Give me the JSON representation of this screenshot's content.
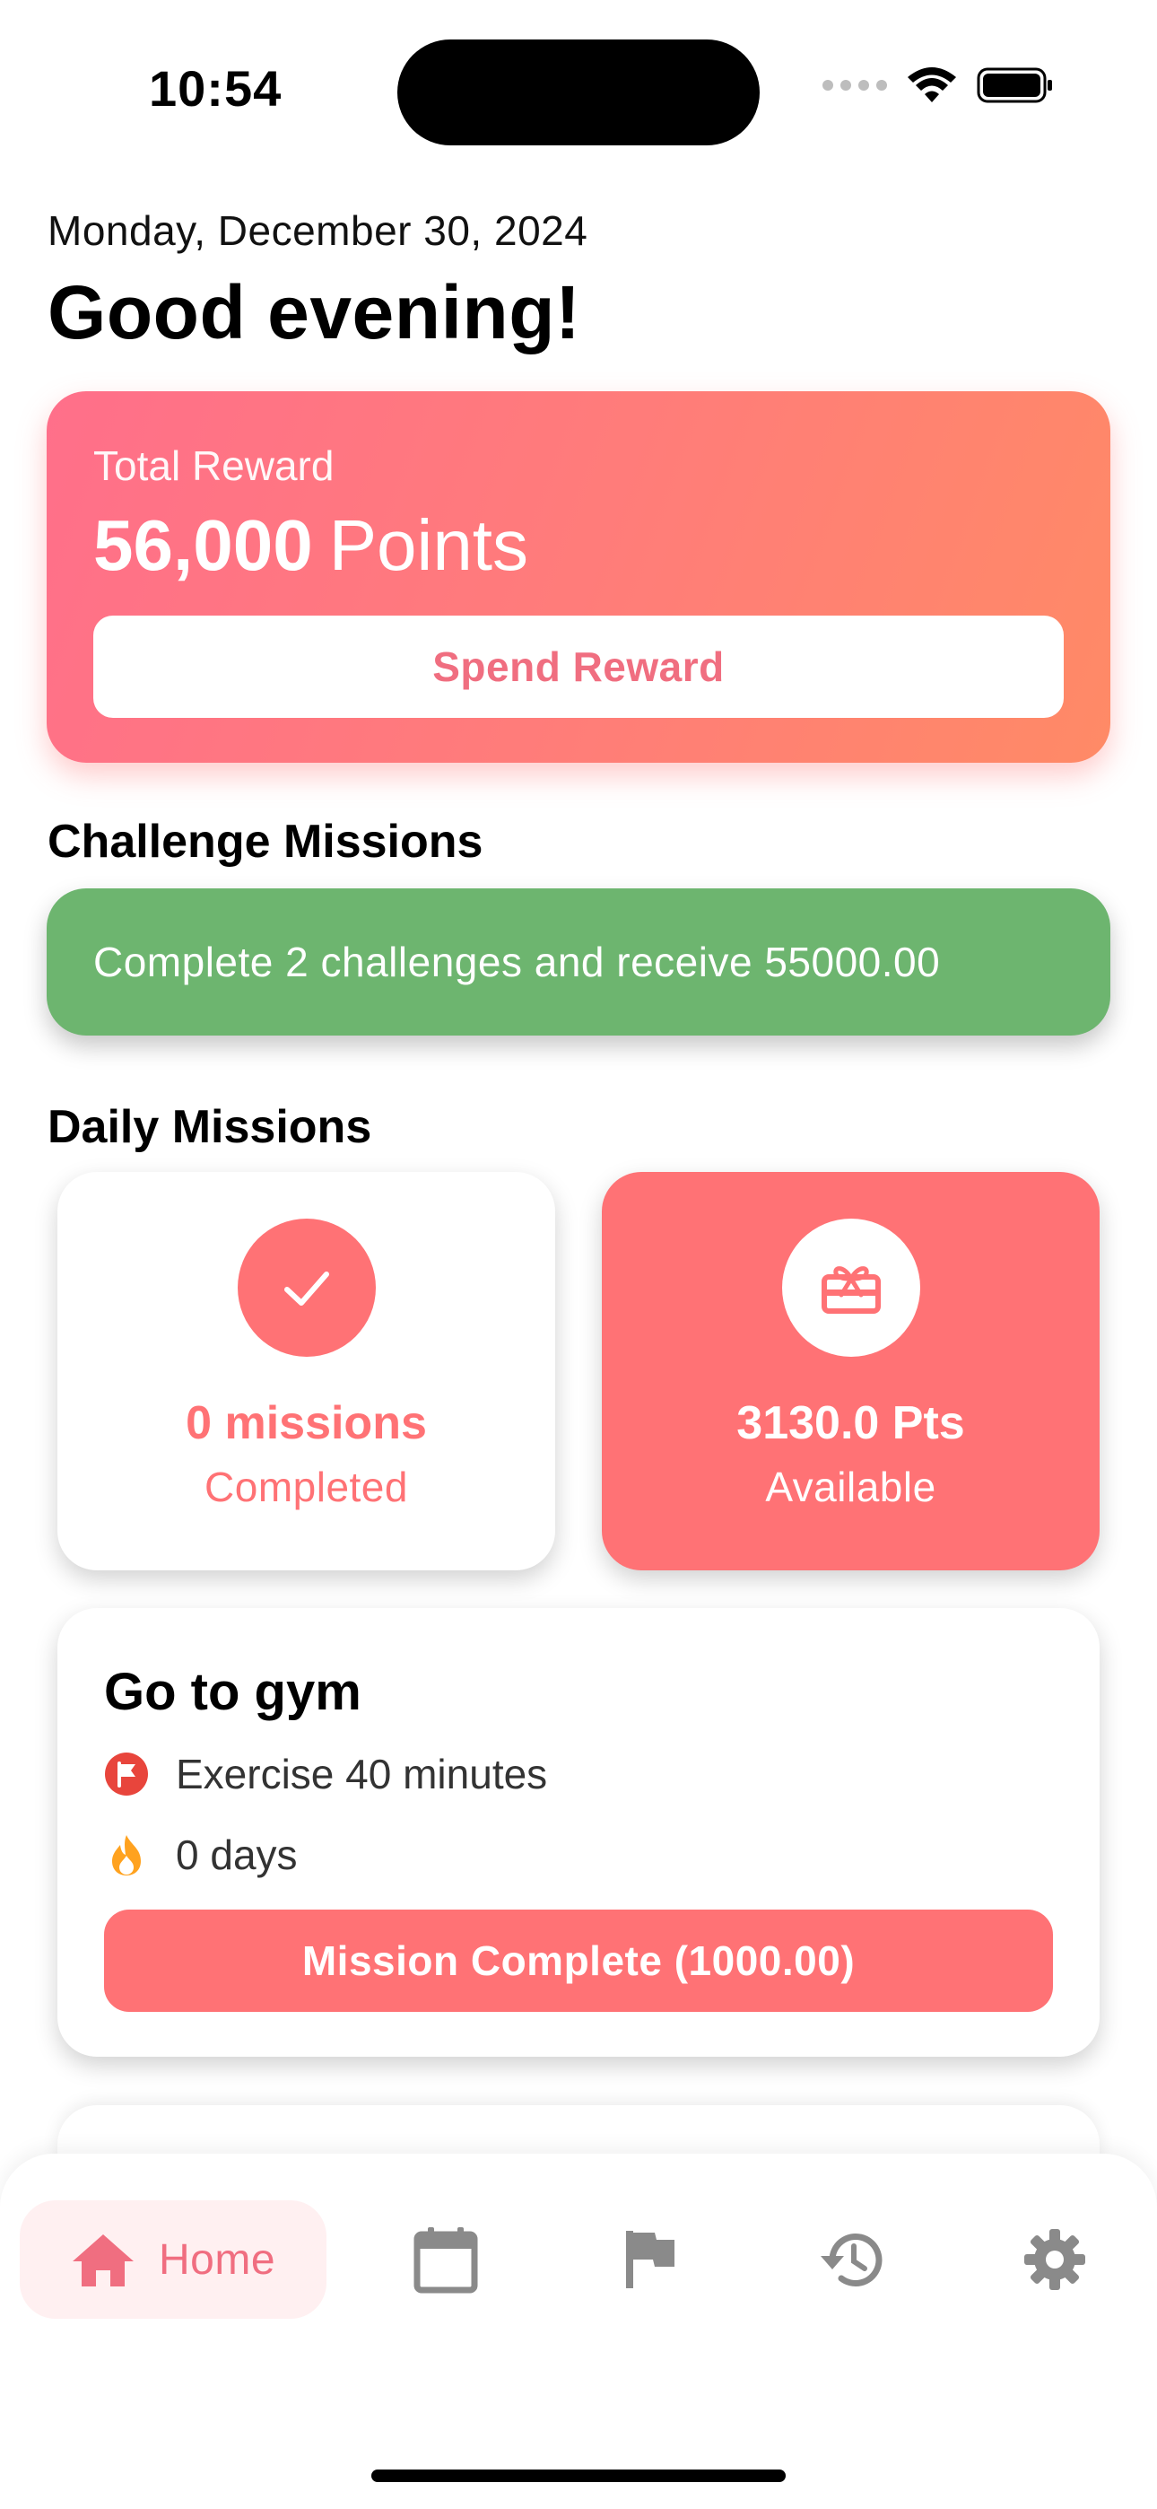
{
  "status_bar": {
    "time": "10:54"
  },
  "header": {
    "date": "Monday, December 30, 2024",
    "greeting": "Good evening!"
  },
  "reward": {
    "label": "Total Reward",
    "points": "56,000",
    "unit": "Points",
    "spend_label": "Spend Reward"
  },
  "challenge": {
    "section_title": "Challenge Missions",
    "text": "Complete 2 challenges and receive 55000.00"
  },
  "daily": {
    "section_title": "Daily Missions",
    "completed_value": "0 missions",
    "completed_label": "Completed",
    "available_value": "3130.0 Pts",
    "available_label": "Available"
  },
  "mission": {
    "title": "Go to gym",
    "goal": "Exercise 40 minutes",
    "streak": "0 days",
    "button_label": "Mission Complete (1000.00)"
  },
  "nav": {
    "home_label": "Home",
    "items": [
      "home",
      "calendar",
      "flag",
      "history",
      "settings"
    ]
  },
  "colors": {
    "accent": "#ff7275",
    "accent_text": "#f06e80",
    "challenge_green": "#6db56f",
    "nav_icon_gray": "#8a8a8a"
  }
}
